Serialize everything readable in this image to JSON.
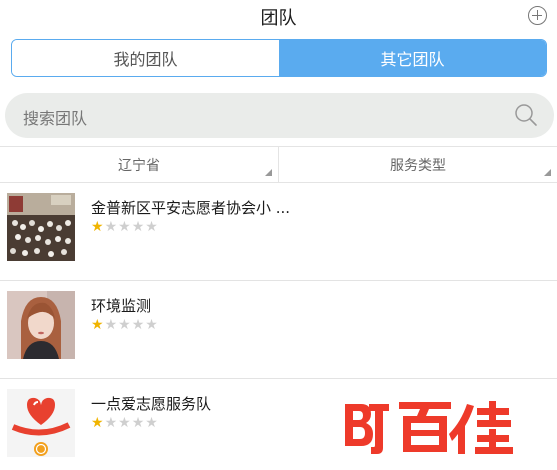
{
  "header": {
    "title": "团队",
    "add_icon": "plus-circle-icon"
  },
  "segments": {
    "items": [
      {
        "label": "我的团队",
        "active": false
      },
      {
        "label": "其它团队",
        "active": true
      }
    ],
    "accent": "#5aabef"
  },
  "search": {
    "placeholder": "搜索团队",
    "icon": "search-icon"
  },
  "filters": [
    {
      "label": "辽宁省"
    },
    {
      "label": "服务类型"
    }
  ],
  "teams": [
    {
      "name": "金普新区平安志愿者协会小 ...",
      "rating": 1,
      "max_rating": 5
    },
    {
      "name": "环境监测",
      "rating": 1,
      "max_rating": 5
    },
    {
      "name": "一点爱志愿服务队",
      "rating": 1,
      "max_rating": 5
    }
  ],
  "colors": {
    "star_on": "#f0b400",
    "star_off": "#cfcfcf",
    "watermark": "#ee3a2a"
  },
  "watermark": {
    "text": "BT百佳"
  }
}
